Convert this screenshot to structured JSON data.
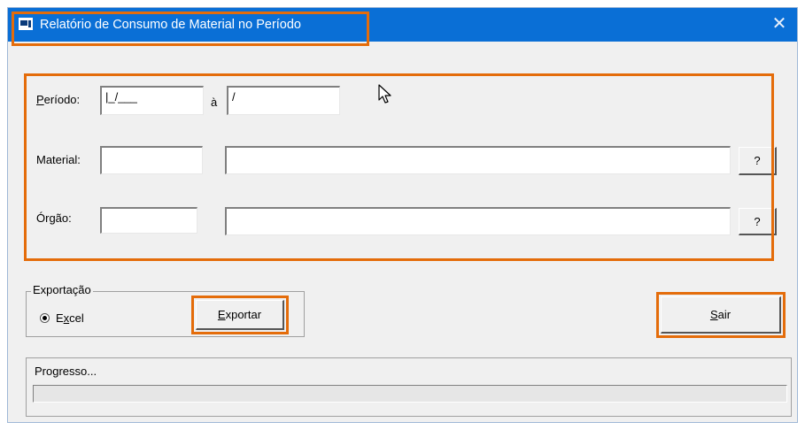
{
  "window": {
    "title": "Relatório de Consumo de Material no Período",
    "close_glyph": "✕",
    "icon": "app-window-icon"
  },
  "filters": {
    "periodo_label_accel": "P",
    "periodo_label_rest": "eríodo:",
    "periodo_start_value": "|_/___",
    "periodo_separator": "à",
    "periodo_end_value": "/",
    "material_label": "Material:",
    "material_code_value": "",
    "material_desc_value": "",
    "material_lookup_label": "?",
    "orgao_label": "Órgão:",
    "orgao_code_value": "",
    "orgao_desc_value": "",
    "orgao_lookup_label": "?"
  },
  "export": {
    "group_label": "Exportação",
    "option_accel_prefix": "E",
    "option_accel": "x",
    "option_rest": "cel",
    "option_selected": true,
    "export_button_accel": "E",
    "export_button_rest": "xportar"
  },
  "exit": {
    "accel": "S",
    "rest": "air"
  },
  "progress": {
    "label": "Progresso...",
    "value": 0
  },
  "colors": {
    "titlebar": "#0a6fd6",
    "highlight": "#e46c0a",
    "dialog_bg": "#f0f0f0"
  }
}
